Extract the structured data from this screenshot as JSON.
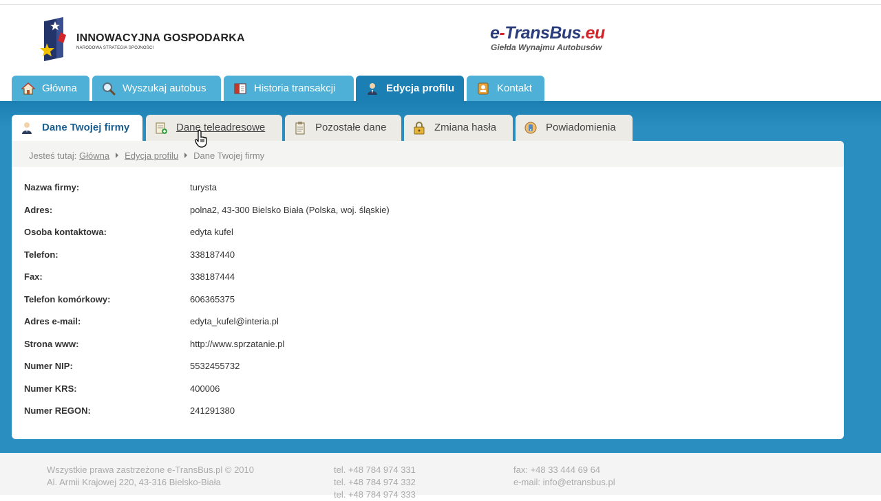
{
  "header": {
    "left_logo_title": "INNOWACYJNA GOSPODARKA",
    "left_logo_subtitle": "NARODOWA STRATEGIA SPÓJNOŚCI",
    "brand_prefix": "e",
    "brand_dash": "-",
    "brand_main": "TransBus",
    "brand_suffix": ".eu",
    "brand_tagline": "Giełda Wynajmu Autobusów"
  },
  "main_nav": [
    {
      "label": "Główna",
      "icon": "home-icon"
    },
    {
      "label": "Wyszukaj autobus",
      "icon": "magnifier-icon"
    },
    {
      "label": "Historia transakcji",
      "icon": "book-icon"
    },
    {
      "label": "Edycja profilu",
      "icon": "user-icon",
      "active": true
    },
    {
      "label": "Kontakt",
      "icon": "contact-book-icon"
    }
  ],
  "sub_nav": [
    {
      "label": "Dane Twojej firmy",
      "icon": "user-icon",
      "active": true
    },
    {
      "label": "Dane teleadresowe",
      "icon": "card-add-icon"
    },
    {
      "label": "Pozostałe dane",
      "icon": "clipboard-icon"
    },
    {
      "label": "Zmiana hasła",
      "icon": "lock-icon"
    },
    {
      "label": "Powiadomienia",
      "icon": "notification-icon"
    }
  ],
  "breadcrumb": {
    "prefix": "Jesteś tutaj:",
    "items": [
      "Główna",
      "Edycja profilu"
    ],
    "current": "Dane Twojej firmy"
  },
  "company": [
    {
      "label": "Nazwa firmy:",
      "value": "turysta"
    },
    {
      "label": "Adres:",
      "value": "polna2, 43-300 Bielsko Biała (Polska, woj. śląskie)"
    },
    {
      "label": "Osoba kontaktowa:",
      "value": "edyta kufel"
    },
    {
      "label": "Telefon:",
      "value": "338187440"
    },
    {
      "label": "Fax:",
      "value": "338187444"
    },
    {
      "label": "Telefon komórkowy:",
      "value": "606365375"
    },
    {
      "label": "Adres e-mail:",
      "value": "edyta_kufel@interia.pl"
    },
    {
      "label": "Strona www:",
      "value": "http://www.sprzatanie.pl"
    },
    {
      "label": "Numer NIP:",
      "value": "5532455732"
    },
    {
      "label": "Numer KRS:",
      "value": "400006"
    },
    {
      "label": "Numer REGON:",
      "value": "241291380"
    }
  ],
  "footer": {
    "copyright": "Wszystkie prawa zastrzeżone e-TransBus.pl © 2010",
    "address": "Al. Armii Krajowej 220, 43-316 Bielsko-Biała",
    "tel1": "tel. +48 784 974 331",
    "tel2": "tel. +48 784 974 332",
    "tel3": "tel. +48 784 974 333",
    "fax": "fax: +48 33 444 69 64",
    "email": "e-mail: info@etransbus.pl"
  },
  "colors": {
    "accent_blue": "#2a8fc0",
    "tab_blue": "#4eb0d6",
    "active_tab_blue": "#1b7fb3",
    "brand_red": "#d0262b",
    "brand_navy": "#2a3d7a"
  }
}
